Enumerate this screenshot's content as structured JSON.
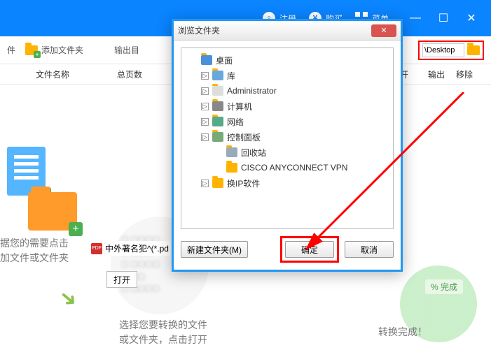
{
  "titlebar": {
    "register": "注册",
    "buy": "购买",
    "menu": "菜单",
    "min": "—",
    "max": "☐",
    "close": "✕"
  },
  "toolbar": {
    "add_file": "件",
    "add_folder": "添加文件夹",
    "output_label": "输出目",
    "path_value": "\\Desktop"
  },
  "columns": {
    "name": "文件名称",
    "pages": "总页数",
    "open": "开",
    "output": "输出",
    "remove": "移除"
  },
  "guide": {
    "step1_a": "据您的需要点击",
    "step1_b": "加文件或文件夹",
    "pdf_name": "中外著名犯^(*.pd",
    "open": "打开",
    "step2_a": "选择您要转换的文件",
    "step2_b": "或文件夹，点击打开",
    "status": "% 完成",
    "step3": "转换完成！"
  },
  "dialog": {
    "title": "浏览文件夹",
    "tree": [
      {
        "label": "桌面",
        "icon": "desktop",
        "indent": 0,
        "exp": ""
      },
      {
        "label": "库",
        "icon": "lib",
        "indent": 1,
        "exp": "▷"
      },
      {
        "label": "Administrator",
        "icon": "user",
        "indent": 1,
        "exp": "▷"
      },
      {
        "label": "计算机",
        "icon": "pc",
        "indent": 1,
        "exp": "▷"
      },
      {
        "label": "网络",
        "icon": "net",
        "indent": 1,
        "exp": "▷"
      },
      {
        "label": "控制面板",
        "icon": "ctrl",
        "indent": 1,
        "exp": "▷"
      },
      {
        "label": "回收站",
        "icon": "bin",
        "indent": 2,
        "exp": ""
      },
      {
        "label": "CISCO ANYCONNECT VPN",
        "icon": "fold",
        "indent": 2,
        "exp": ""
      },
      {
        "label": "换IP软件",
        "icon": "fold",
        "indent": 1,
        "exp": "▷"
      }
    ],
    "new_folder": "新建文件夹(M)",
    "ok": "确定",
    "cancel": "取消"
  }
}
